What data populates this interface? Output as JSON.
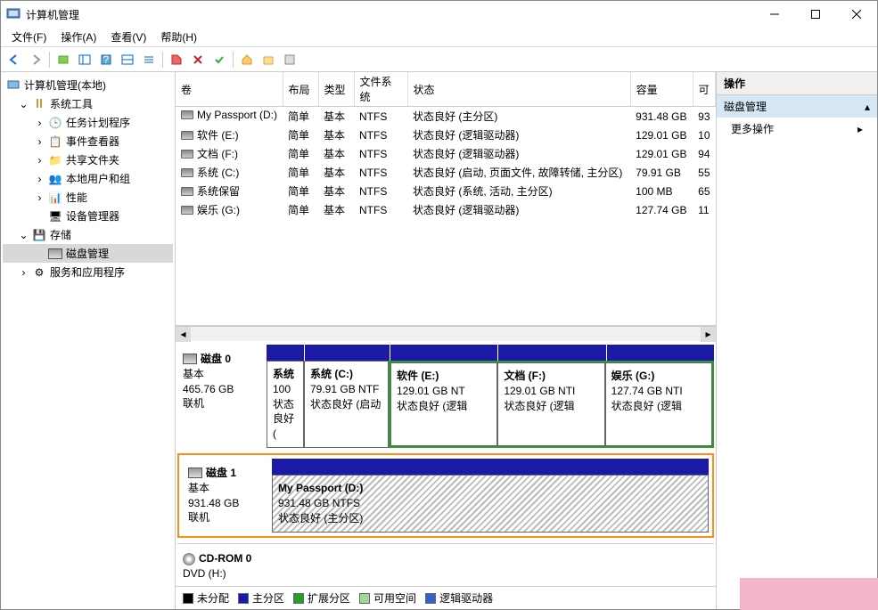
{
  "window": {
    "title": "计算机管理"
  },
  "menu": {
    "file": "文件(F)",
    "action": "操作(A)",
    "view": "查看(V)",
    "help": "帮助(H)"
  },
  "tree": {
    "root": "计算机管理(本地)",
    "tools": "系统工具",
    "scheduler": "任务计划程序",
    "event": "事件查看器",
    "shared": "共享文件夹",
    "users": "本地用户和组",
    "perf": "性能",
    "devmgr": "设备管理器",
    "storage": "存储",
    "diskmgmt": "磁盘管理",
    "services": "服务和应用程序"
  },
  "cols": {
    "vol": "卷",
    "layout": "布局",
    "type": "类型",
    "fs": "文件系统",
    "status": "状态",
    "cap": "容量",
    "free": "可"
  },
  "volumes": [
    {
      "name": "My Passport (D:)",
      "layout": "简单",
      "type": "基本",
      "fs": "NTFS",
      "status": "状态良好 (主分区)",
      "cap": "931.48 GB",
      "free": "93"
    },
    {
      "name": "软件 (E:)",
      "layout": "简单",
      "type": "基本",
      "fs": "NTFS",
      "status": "状态良好 (逻辑驱动器)",
      "cap": "129.01 GB",
      "free": "10"
    },
    {
      "name": "文档 (F:)",
      "layout": "简单",
      "type": "基本",
      "fs": "NTFS",
      "status": "状态良好 (逻辑驱动器)",
      "cap": "129.01 GB",
      "free": "94"
    },
    {
      "name": "系统 (C:)",
      "layout": "简单",
      "type": "基本",
      "fs": "NTFS",
      "status": "状态良好 (启动, 页面文件, 故障转储, 主分区)",
      "cap": "79.91 GB",
      "free": "55"
    },
    {
      "name": "系统保留",
      "layout": "简单",
      "type": "基本",
      "fs": "NTFS",
      "status": "状态良好 (系统, 活动, 主分区)",
      "cap": "100 MB",
      "free": "65"
    },
    {
      "name": "娱乐 (G:)",
      "layout": "简单",
      "type": "基本",
      "fs": "NTFS",
      "status": "状态良好 (逻辑驱动器)",
      "cap": "127.74 GB",
      "free": "11"
    }
  ],
  "disk0": {
    "title": "磁盘 0",
    "type": "基本",
    "size": "465.76 GB",
    "status": "联机",
    "parts": [
      {
        "name": "系统",
        "line2": "100",
        "line3": "状态良好 ("
      },
      {
        "name": "系统  (C:)",
        "line2": "79.91 GB NTF",
        "line3": "状态良好 (启动"
      },
      {
        "name": "软件  (E:)",
        "line2": "129.01 GB NT",
        "line3": "状态良好 (逻辑"
      },
      {
        "name": "文档  (F:)",
        "line2": "129.01 GB NTI",
        "line3": "状态良好 (逻辑"
      },
      {
        "name": "娱乐  (G:)",
        "line2": "127.74 GB NTI",
        "line3": "状态良好 (逻辑"
      }
    ]
  },
  "disk1": {
    "title": "磁盘 1",
    "type": "基本",
    "size": "931.48 GB",
    "status": "联机",
    "part": {
      "name": "My Passport  (D:)",
      "line2": "931.48 GB NTFS",
      "line3": "状态良好 (主分区)"
    }
  },
  "cdrom": {
    "title": "CD-ROM 0",
    "line2": "DVD (H:)"
  },
  "legend": {
    "unalloc": "未分配",
    "primary": "主分区",
    "ext": "扩展分区",
    "free": "可用空间",
    "logical": "逻辑驱动器"
  },
  "actions": {
    "header": "操作",
    "diskmgmt": "磁盘管理",
    "more": "更多操作"
  }
}
